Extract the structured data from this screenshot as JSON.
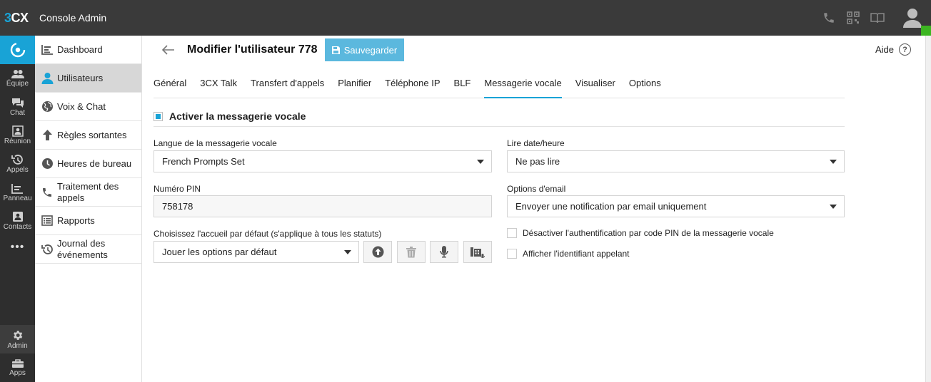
{
  "app": {
    "logo": "3CX",
    "title": "Console Admin"
  },
  "rail": {
    "items": [
      {
        "label": "Équipe",
        "icon": "team-icon"
      },
      {
        "label": "Chat",
        "icon": "chat-icon"
      },
      {
        "label": "Réunion",
        "icon": "meeting-icon"
      },
      {
        "label": "Appels",
        "icon": "call-history-icon"
      },
      {
        "label": "Panneau",
        "icon": "panel-icon"
      },
      {
        "label": "Contacts",
        "icon": "contacts-icon"
      }
    ],
    "more": "•••",
    "admin": "Admin",
    "apps": "Apps"
  },
  "sidebar": {
    "items": [
      {
        "label": "Dashboard",
        "icon": "dashboard-icon",
        "active": false
      },
      {
        "label": "Utilisateurs",
        "icon": "user-icon",
        "active": true
      },
      {
        "label": "Voix & Chat",
        "icon": "globe-icon",
        "active": false
      },
      {
        "label": "Règles sortantes",
        "icon": "arrow-up-icon",
        "active": false
      },
      {
        "label": "Heures de bureau",
        "icon": "clock-icon",
        "active": false
      },
      {
        "label": "Traitement des appels",
        "icon": "phone-icon",
        "active": false
      },
      {
        "label": "Rapports",
        "icon": "reports-icon",
        "active": false
      },
      {
        "label": "Journal des événements",
        "icon": "history-icon",
        "active": false
      }
    ]
  },
  "header": {
    "title": "Modifier l'utilisateur 778",
    "save_label": "Sauvegarder",
    "help_label": "Aide"
  },
  "tabs": [
    {
      "label": "Général",
      "active": false
    },
    {
      "label": "3CX Talk",
      "active": false
    },
    {
      "label": "Transfert d'appels",
      "active": false
    },
    {
      "label": "Planifier",
      "active": false
    },
    {
      "label": "Téléphone IP",
      "active": false
    },
    {
      "label": "BLF",
      "active": false
    },
    {
      "label": "Messagerie vocale",
      "active": true
    },
    {
      "label": "Visualiser",
      "active": false
    },
    {
      "label": "Options",
      "active": false
    }
  ],
  "voicemail": {
    "enable_label": "Activer la messagerie vocale",
    "enabled": true,
    "language": {
      "label": "Langue de la messagerie vocale",
      "value": "French Prompts Set"
    },
    "pin": {
      "label": "Numéro PIN",
      "value": "758178"
    },
    "greeting": {
      "label": "Choisissez l'accueil par défaut (s'applique à tous les statuts)",
      "value": "Jouer les options par défaut"
    },
    "read_datetime": {
      "label": "Lire date/heure",
      "value": "Ne pas lire"
    },
    "email_options": {
      "label": "Options d'email",
      "value": "Envoyer une notification par email uniquement"
    },
    "disable_pin_auth": {
      "label": "Désactiver l'authentification par code PIN de la messagerie vocale",
      "checked": false
    },
    "show_caller_id": {
      "label": "Afficher l'identifiant appelant",
      "checked": false
    }
  },
  "colors": {
    "accent": "#19a3d6",
    "topbar": "#3a3a3a",
    "rail": "#2e2e2e",
    "save_button": "#5bb8de",
    "status_online": "#3cb521"
  }
}
